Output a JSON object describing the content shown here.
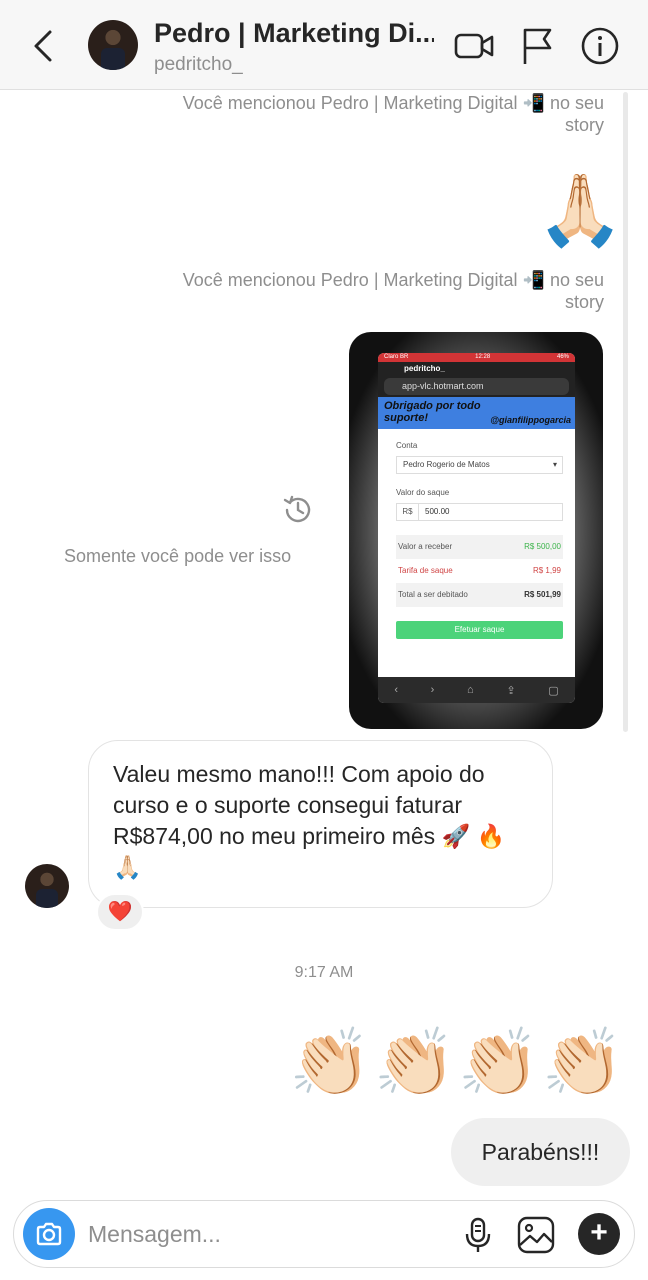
{
  "header": {
    "title": "Pedro | Marketing Di...",
    "subtitle": "pedritcho_"
  },
  "notices": {
    "mention_1": "Você mencionou Pedro | Marketing Digital 📲 no seu story",
    "mention_2": "Você mencionou Pedro | Marketing Digital 📲 no seu story",
    "only_you": "Somente você pode ver isso"
  },
  "emoji_sent_1": "🙏🏻",
  "story": {
    "status_left": "Claro BR",
    "status_time": "12:28",
    "status_right": "46%",
    "username": "pedritcho_",
    "url": "app-vlc.hotmart.com",
    "banner_text": "Obrigado por todo suporte!",
    "banner_handle": "@gianfilippogarcia",
    "conta_label": "Conta",
    "conta_value": "Pedro Rogerio de Matos",
    "saque_label": "Valor do saque",
    "currency": "R$",
    "amount": "500.00",
    "rows": [
      {
        "label": "Valor a receber",
        "value": "R$ 500,00",
        "color": "#3cb44b"
      },
      {
        "label": "Tarifa de saque",
        "value": "R$ 1,99",
        "color": "#d04545"
      },
      {
        "label": "Total a ser debitado",
        "value": "R$ 501,99",
        "color": "#333333"
      }
    ],
    "button": "Efetuar saque"
  },
  "received_message": {
    "text": "Valeu mesmo mano!!! Com apoio do curso e o suporte consegui faturar R$874,00 no meu primeiro mês 🚀 🔥🙏🏻",
    "reaction": "❤️"
  },
  "timestamp": "9:17 AM",
  "emoji_sent_2": "👏🏻👏🏻👏🏻👏🏻",
  "sent_message": "Parabéns!!!",
  "composer": {
    "placeholder": "Mensagem..."
  },
  "colors": {
    "accent": "#3797f0",
    "bubble_sent": "#efefef",
    "muted_text": "#8e8e8e"
  }
}
